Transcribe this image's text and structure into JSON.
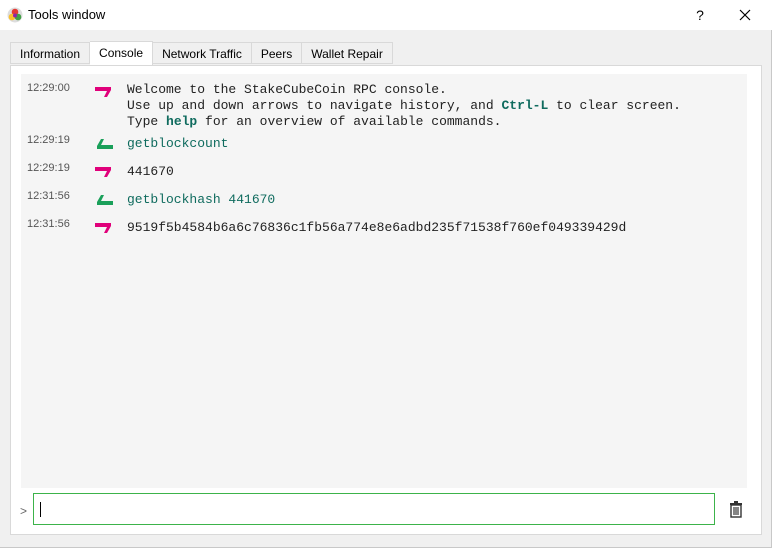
{
  "window": {
    "title": "Tools window",
    "help_label": "?"
  },
  "tabs": [
    {
      "label": "Information",
      "active": false
    },
    {
      "label": "Console",
      "active": true
    },
    {
      "label": "Network Traffic",
      "active": false
    },
    {
      "label": "Peers",
      "active": false
    },
    {
      "label": "Wallet Repair",
      "active": false
    }
  ],
  "console": {
    "entries": [
      {
        "time": "12:29:00",
        "direction": "reply",
        "welcome": {
          "line1": "Welcome to the StakeCubeCoin RPC console.",
          "line2_pre": "Use up and down arrows to navigate history, and ",
          "line2_kw": "Ctrl-L",
          "line2_post": " to clear screen.",
          "line3_pre": "Type ",
          "line3_kw": "help",
          "line3_post": " for an overview of available commands."
        }
      },
      {
        "time": "12:29:19",
        "direction": "request",
        "text": "getblockcount"
      },
      {
        "time": "12:29:19",
        "direction": "reply",
        "text": "441670"
      },
      {
        "time": "12:31:56",
        "direction": "request",
        "text": "getblockhash 441670"
      },
      {
        "time": "12:31:56",
        "direction": "reply",
        "text": "9519f5b4584b6a6c76836c1fb56a774e8e6adbd235f71538f760ef049339429d"
      }
    ],
    "prompt": ">",
    "input_value": ""
  },
  "colors": {
    "reply_arrow": "#e0007a",
    "request_arrow": "#1aa05a",
    "command_text": "#0f6b5e",
    "input_border": "#3cb34a"
  },
  "icons": {
    "app": "stakecubecoin-logo-icon",
    "close": "close-icon",
    "clear": "trash-icon"
  }
}
